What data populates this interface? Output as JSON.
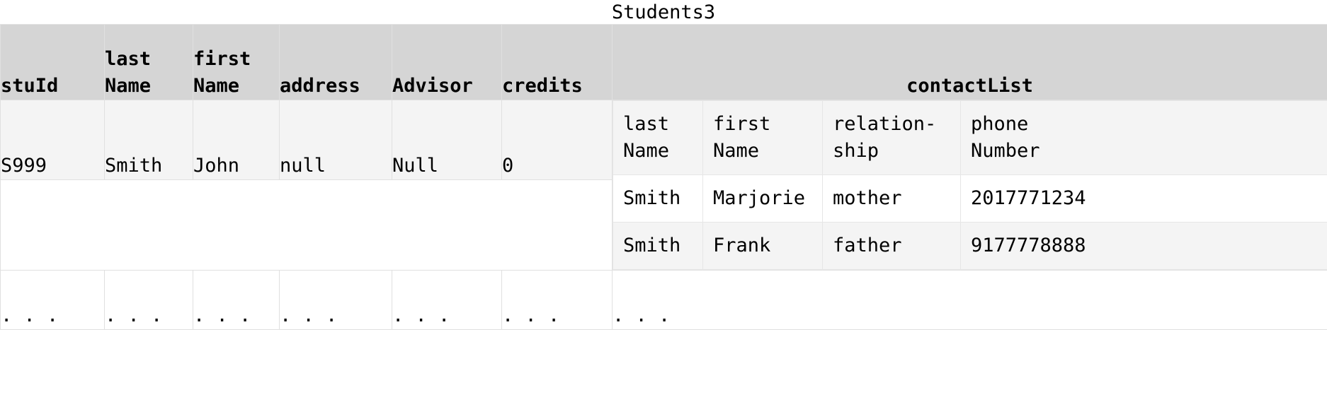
{
  "title": "Students3",
  "colors": {
    "header_bg": "#d5d5d5",
    "cell_bg": "#f4f4f4",
    "row_alt_bg": "#ffffff",
    "border": "#e0e0e0",
    "text": "#000000"
  },
  "columns": [
    {
      "key": "stuId",
      "label": "stuId"
    },
    {
      "key": "lastName",
      "label": "last\nName"
    },
    {
      "key": "firstName",
      "label": "first\nName"
    },
    {
      "key": "address",
      "label": "address"
    },
    {
      "key": "advisor",
      "label": "Advisor"
    },
    {
      "key": "credits",
      "label": "credits"
    },
    {
      "key": "contactList",
      "label": "contactList"
    }
  ],
  "row": {
    "stuId": "S999",
    "lastName": "Smith",
    "firstName": "John",
    "address": "null",
    "advisor": "Null",
    "credits": "0"
  },
  "contact_list": {
    "headers": [
      "last\nName",
      "first\nName",
      "relation-\nship",
      "phone\nNumber"
    ],
    "rows": [
      {
        "lastName": "Smith",
        "firstName": "Marjorie",
        "relationship": "mother",
        "phoneNumber": "2017771234"
      },
      {
        "lastName": "Smith",
        "firstName": "Frank",
        "relationship": "father",
        "phoneNumber": "9177778888"
      }
    ]
  },
  "ellipsis_row": {
    "stuId": ". . .",
    "lastName": ". . .",
    "firstName": ". . .",
    "address": ". . .",
    "advisor": ". . .",
    "credits": ". . .",
    "contactList": ". . ."
  }
}
